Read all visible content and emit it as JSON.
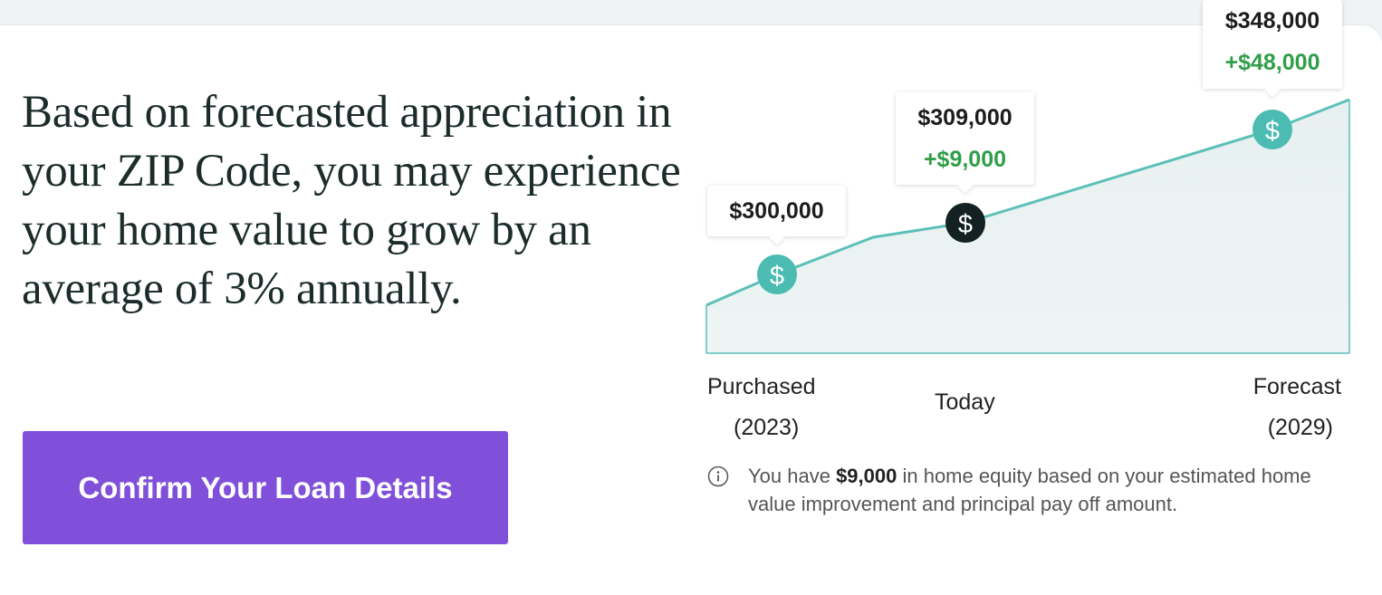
{
  "headline": "Based on forecasted appreciation in your ZIP Code, you may experience your home value to grow by an average of 3% annually.",
  "cta": {
    "label": "Confirm Your Loan Details"
  },
  "chart_data": {
    "type": "area",
    "points": [
      {
        "id": "purchased",
        "value_label": "$300,000",
        "gain_label": ""
      },
      {
        "id": "today",
        "value_label": "$309,000",
        "gain_label": "+$9,000"
      },
      {
        "id": "forecast",
        "value_label": "$348,000",
        "gain_label": "+$48,000"
      }
    ],
    "x_labels": {
      "purchased": "Purchased",
      "purchased_year": "(2023)",
      "today": "Today",
      "forecast": "Forecast",
      "forecast_year": "(2029)"
    },
    "marker_icon": "dollar-sign-icon",
    "colors": {
      "line": "#5cc0b9",
      "fill": "#e7f0f0",
      "marker_teal": "#4cbcb3",
      "marker_current": "#132122",
      "gain": "#2f9e48"
    }
  },
  "note": {
    "icon": "info-icon",
    "prefix": "You have ",
    "amount": "$9,000",
    "suffix": " in home equity based on your estimated home value improvement and principal pay off amount."
  },
  "colors": {
    "cta_background": "#8150da",
    "page_background": "#eff3f5",
    "headline": "#1b2c2b"
  }
}
